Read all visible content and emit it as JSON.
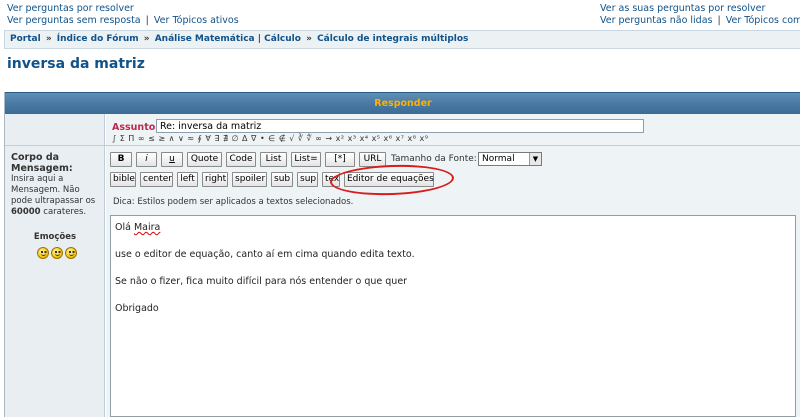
{
  "top_links_left": {
    "unanswered_link": "Ver perguntas por resolver",
    "no_reply_link": "Ver perguntas sem resposta",
    "separator": "|",
    "active_link": "Ver Tópicos ativos"
  },
  "top_links_right": {
    "own_posts_link": "Ver as suas perguntas por resolver",
    "unread_link": "Ver perguntas não lidas",
    "separator": "|",
    "new_topics_link": "Ver Tópicos com per"
  },
  "breadcrumb": {
    "items": [
      "Portal",
      "Índice do Fórum",
      "Análise Matemática | Cálculo",
      "Cálculo de integrais múltiplos"
    ],
    "separator": "»"
  },
  "page_title": "inversa da matriz",
  "form": {
    "header": "Responder",
    "subject_label": "Assunto:",
    "subject_value": "Re: inversa da matriz",
    "symbols": "∫ Σ Π ∞ ≤ ≥ ∧ ∨ ≈ ∮ ∀ ∃ ∄ ∅ Δ ∇ • ∈ ∉ √ ∛ ∜ ∞ → x² x³ x⁴ x⁵ x⁶ x⁷ x⁸ x⁹",
    "body_label": "Corpo da Mensagem:",
    "body_help_prefix": "Insira aqui a Mensagem. Não pode ultrapassar os",
    "body_help_limit": "60000",
    "body_help_suffix": "carateres.",
    "emotions_label": "Emoções",
    "tip": "Dica: Estilos podem ser aplicados a textos selecionados.",
    "font_size_label": "Tamanho da Fonte:",
    "font_size_value": "Normal"
  },
  "toolbar_row1": {
    "bold": "B",
    "italic": "i",
    "underline": "u",
    "quote": "Quote",
    "code": "Code",
    "list": "List",
    "list_num": "List=",
    "list_item": "[*]",
    "url": "URL"
  },
  "toolbar_row2": {
    "bible": "bible",
    "center": "center",
    "left": "left",
    "right": "right",
    "spoiler": "spoiler",
    "sub": "sub",
    "sup": "sup",
    "tex": "tex",
    "equation_editor": "Editor de equações"
  },
  "editor": {
    "greeting_prefix": "Olá",
    "greeting_name": "Maira",
    "line2": "use o editor de equação, canto aí em cima quando edita texto.",
    "line3": "Se não o fizer, fica muito difícil para nós entender o que quer",
    "line4": "Obrigado"
  },
  "colors": {
    "accent_blue": "#105289",
    "header_text": "#ffb100",
    "subject_label": "#bc2a4d",
    "annotation_red": "#d81b1b"
  }
}
